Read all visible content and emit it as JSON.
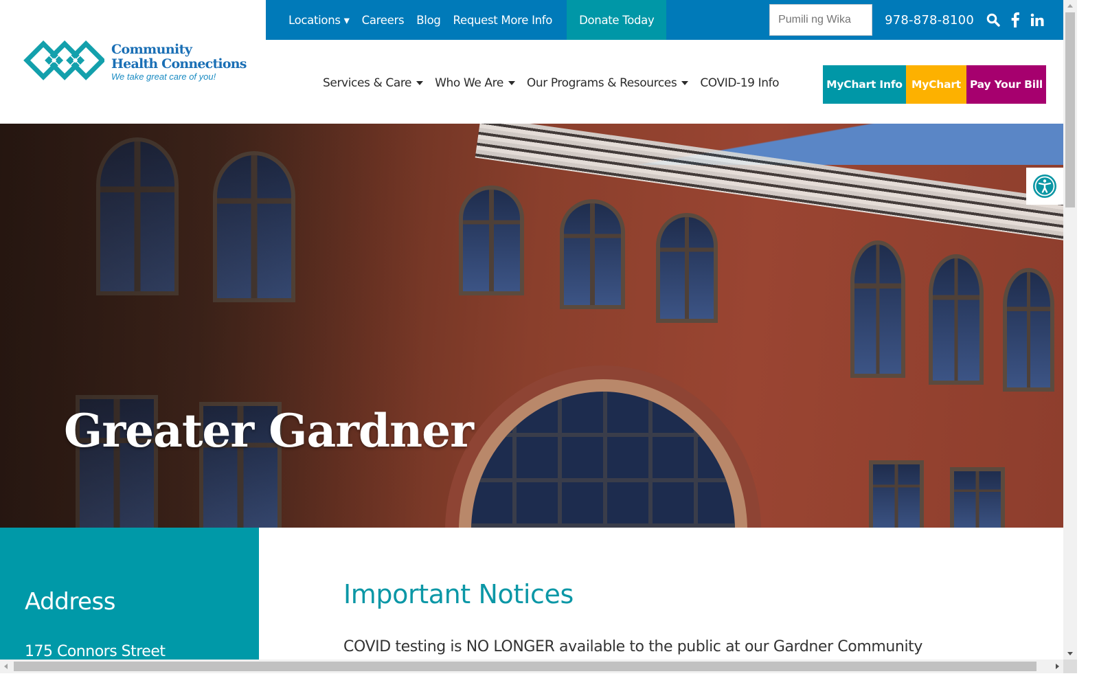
{
  "topbar": {
    "links": [
      "Locations ▾",
      "Careers",
      "Blog",
      "Request More Info"
    ],
    "donate": "Donate Today",
    "language_placeholder": "Pumili ng Wika",
    "phone": "978-878-8100",
    "icons": [
      "search-icon",
      "facebook-icon",
      "linkedin-icon"
    ]
  },
  "logo": {
    "line1": "Community",
    "line2": "Health Connections",
    "tagline": "We take great care of you!"
  },
  "nav": {
    "items": [
      {
        "label": "Services & Care",
        "dropdown": true
      },
      {
        "label": "Who We Are",
        "dropdown": true
      },
      {
        "label": "Our Programs & Resources",
        "dropdown": true
      },
      {
        "label": "COVID-19 Info",
        "dropdown": false
      }
    ]
  },
  "portal": {
    "mychart_info": "MyChart Info",
    "mychart": "MyChart",
    "pay_bill": "Pay Your Bill"
  },
  "hero": {
    "title": "Greater Gardner"
  },
  "sidebar": {
    "heading": "Address",
    "address_line1": "175 Connors Street"
  },
  "notices": {
    "heading": "Important Notices",
    "text": "COVID testing is NO LONGER available to the public at our Gardner Community"
  },
  "colors": {
    "topbar_blue": "#007ab9",
    "teal": "#0097a7",
    "yellow": "#fdb100",
    "magenta": "#a6006e",
    "logo_blue": "#1a6fb5"
  }
}
